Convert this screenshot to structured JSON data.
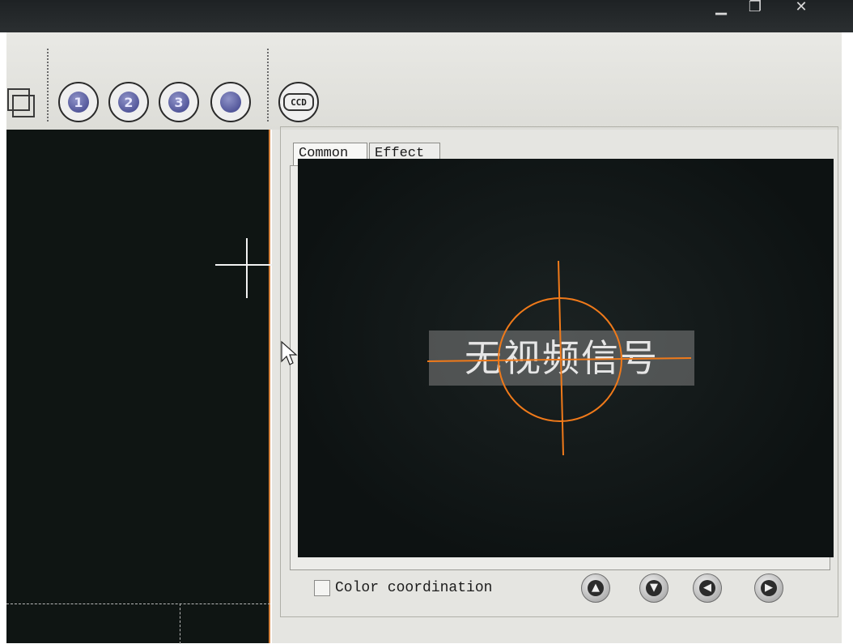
{
  "window": {
    "minimize_glyph": "▁",
    "restore_glyph": "❐",
    "close_glyph": "✕"
  },
  "toolbar": {
    "buttons": [
      {
        "name": "layers-icon",
        "label": ""
      },
      {
        "name": "preset-1",
        "label": "1"
      },
      {
        "name": "preset-2",
        "label": "2"
      },
      {
        "name": "preset-3",
        "label": "3"
      },
      {
        "name": "preset-round",
        "label": ""
      },
      {
        "name": "ccd",
        "label": "CCD"
      }
    ]
  },
  "tabs": [
    {
      "label": "Common",
      "active": true
    },
    {
      "label": "Effect",
      "active": false
    }
  ],
  "video": {
    "no_signal_text": "无视频信号",
    "crosshair_color": "#f07a1a"
  },
  "controls": {
    "color_coordination_label": "Color coordination",
    "color_coordination_checked": false,
    "arrows": [
      "up",
      "down",
      "left",
      "right"
    ],
    "arrow_glyphs": {
      "up": "▲",
      "down": "▼",
      "left": "◀",
      "right": "▶"
    }
  },
  "colors": {
    "accent": "#d4803a",
    "background_dark": "#0f1513"
  }
}
